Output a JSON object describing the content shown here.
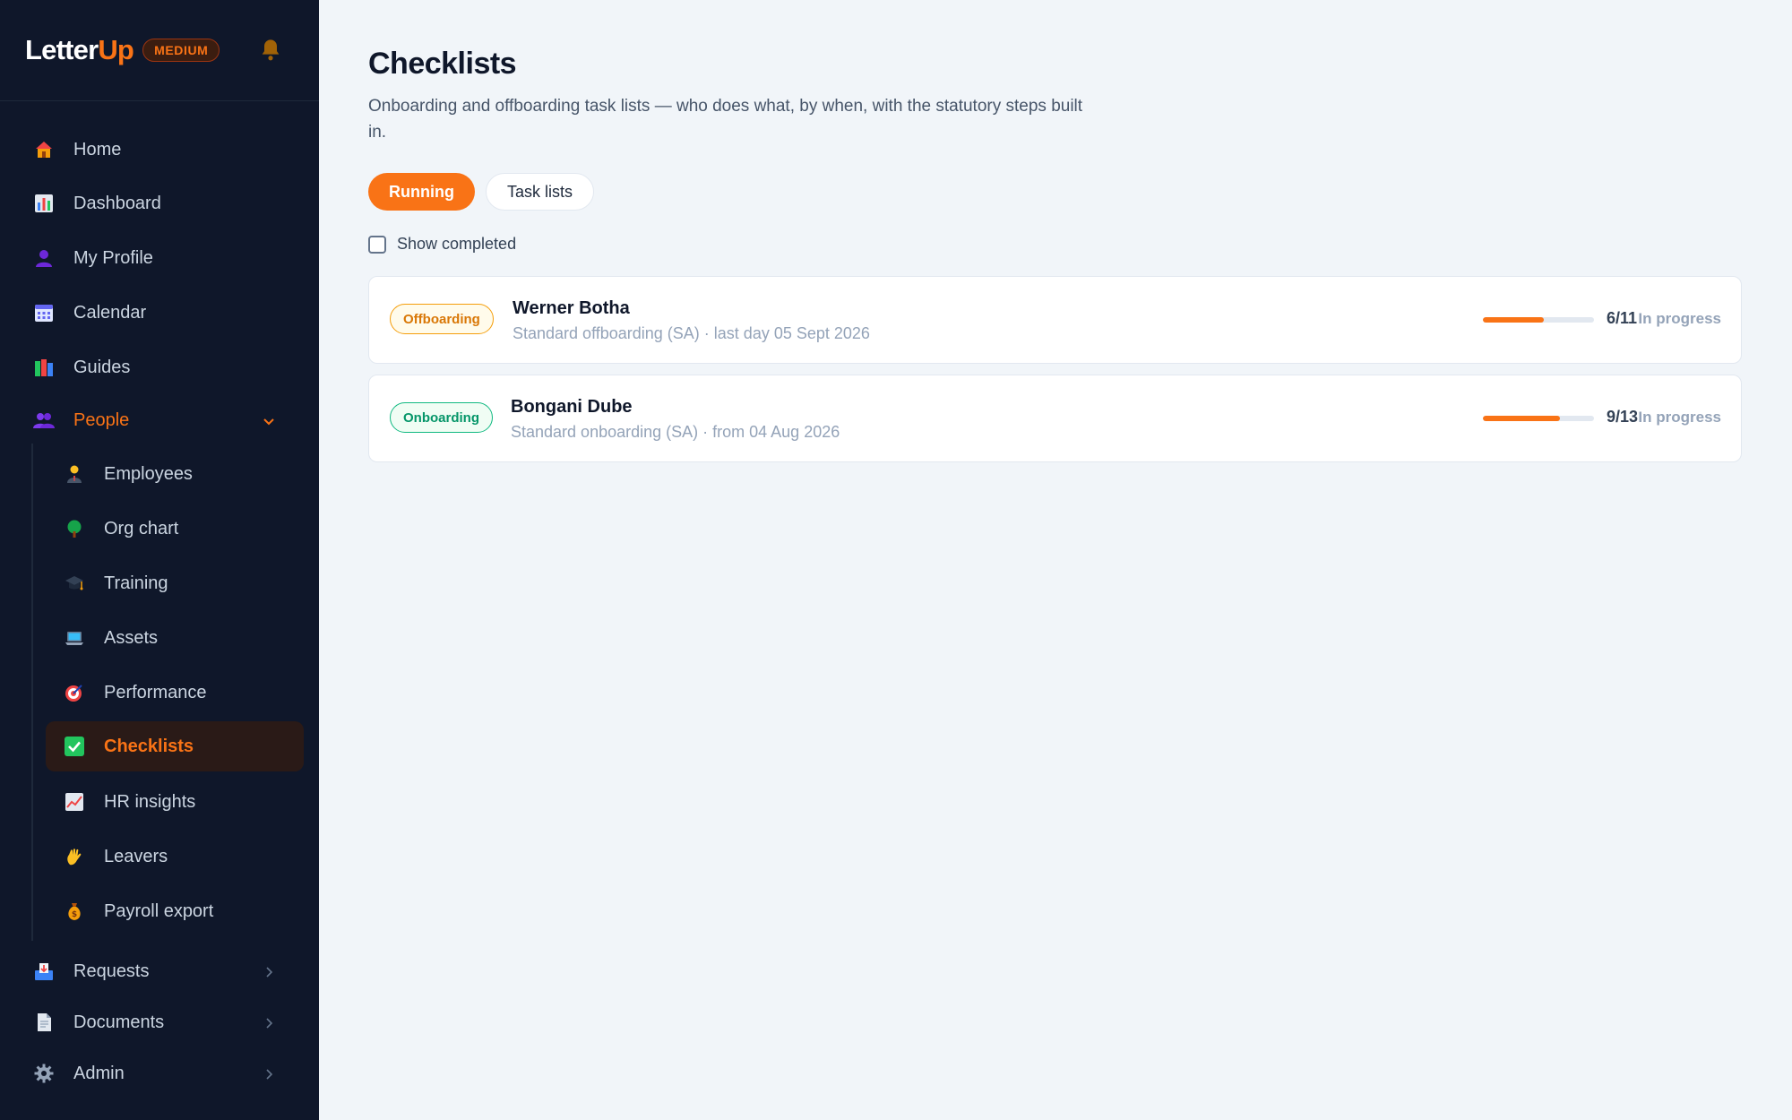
{
  "brand": {
    "name_main": "Letter",
    "name_accent": "Up",
    "tier": "MEDIUM"
  },
  "nav": {
    "home": "Home",
    "dashboard": "Dashboard",
    "my_profile": "My Profile",
    "calendar": "Calendar",
    "guides": "Guides",
    "people": "People",
    "employees": "Employees",
    "org_chart": "Org chart",
    "training": "Training",
    "assets": "Assets",
    "performance": "Performance",
    "checklists": "Checklists",
    "hr_insights": "HR insights",
    "leavers": "Leavers",
    "payroll_export": "Payroll export",
    "requests": "Requests",
    "documents": "Documents",
    "admin": "Admin"
  },
  "page": {
    "title": "Checklists",
    "description": "Onboarding and offboarding task lists — who does what, by when, with the statutory steps built in."
  },
  "tabs": {
    "running": "Running",
    "task_lists": "Task lists"
  },
  "filters": {
    "show_completed": "Show completed",
    "show_completed_checked": false
  },
  "checklists": [
    {
      "type": "Offboarding",
      "name": "Werner Botha",
      "detail": "Standard offboarding (SA) · last day 05 Sept 2026",
      "progress": "6/11",
      "progress_fraction": 0.545,
      "status": "In progress"
    },
    {
      "type": "Onboarding",
      "name": "Bongani Dube",
      "detail": "Standard onboarding (SA) · from 04 Aug 2026",
      "progress": "9/13",
      "progress_fraction": 0.692,
      "status": "In progress"
    }
  ],
  "colors": {
    "accent": "#f97316",
    "sidebar_bg": "#0f172a",
    "page_bg": "#f1f5f9",
    "offboarding": "#f59e0b",
    "onboarding": "#10b981"
  }
}
